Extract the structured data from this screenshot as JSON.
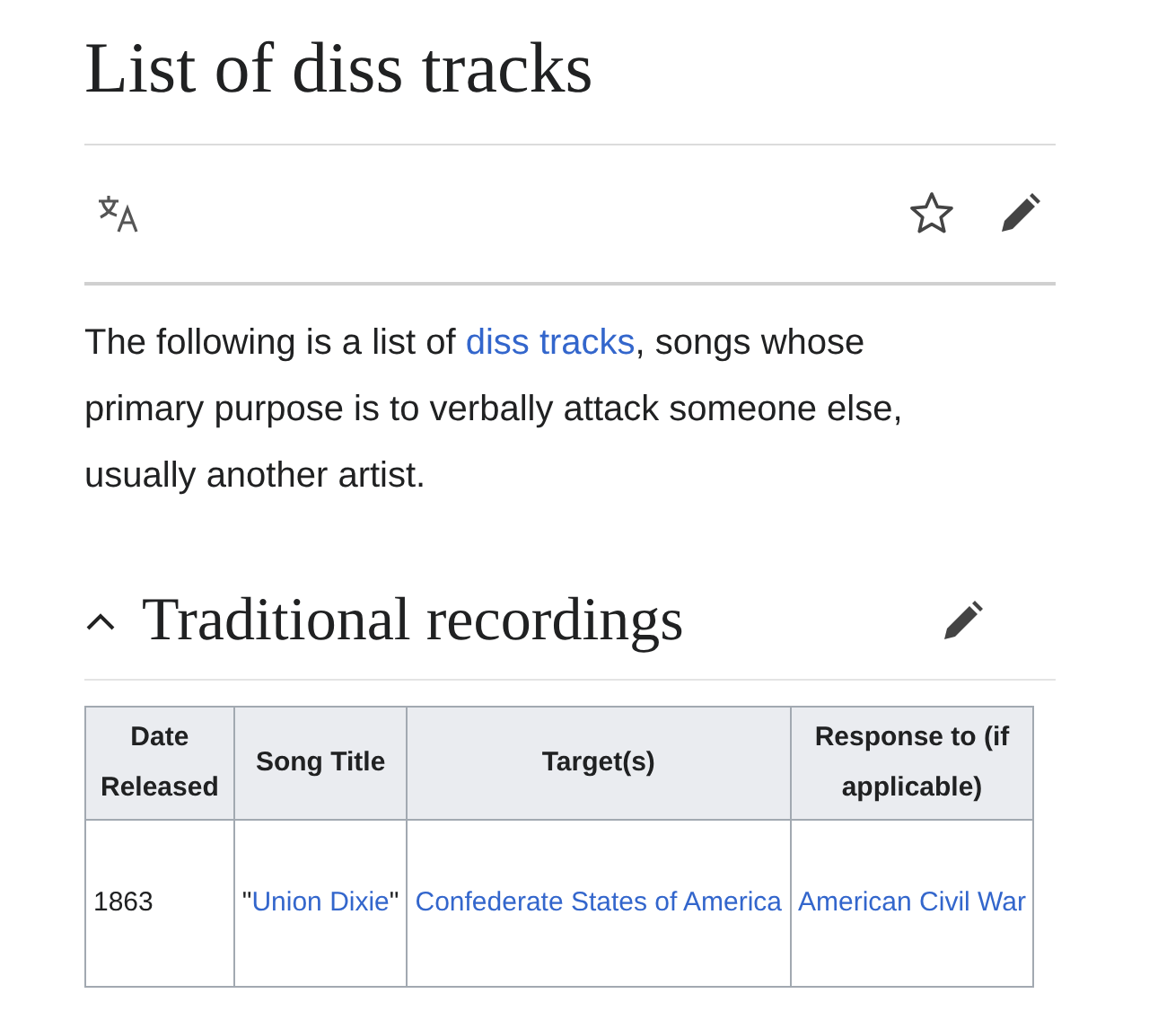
{
  "page_title": "List of diss tracks",
  "intro": [
    {
      "kind": "text",
      "text": "The following is a list of "
    },
    {
      "kind": "link",
      "text": "diss tracks"
    },
    {
      "kind": "text",
      "text": ", songs whose primary purpose is to verbally attack someone else, usually another artist."
    }
  ],
  "section": {
    "title": "Traditional recordings",
    "expanded": true,
    "table": {
      "columns": [
        "Date Released",
        "Song Title",
        "Target(s)",
        "Response to (if applicable)"
      ],
      "rows": [
        [
          [
            {
              "kind": "text",
              "text": "1863"
            }
          ],
          [
            {
              "kind": "text",
              "text": "\""
            },
            {
              "kind": "link",
              "text": "Union Dixie"
            },
            {
              "kind": "text",
              "text": "\""
            }
          ],
          [
            {
              "kind": "link",
              "text": "Confederate States of America"
            }
          ],
          [
            {
              "kind": "link",
              "text": "American Civil War"
            }
          ]
        ]
      ]
    }
  }
}
